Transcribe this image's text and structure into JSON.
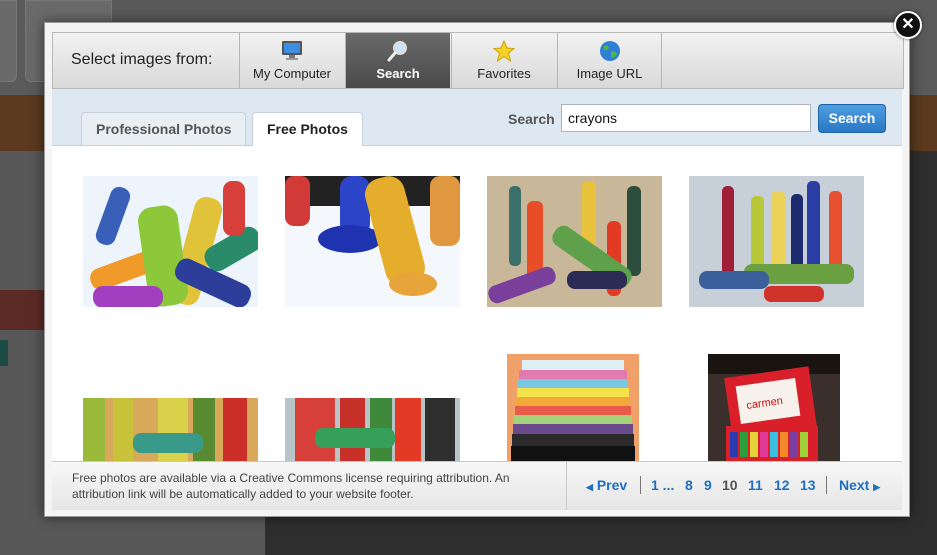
{
  "source_bar": {
    "label": "Select images from:",
    "buttons": [
      {
        "label": "My Computer",
        "icon": "computer-icon",
        "active": false
      },
      {
        "label": "Search",
        "icon": "magnifier-icon",
        "active": true
      },
      {
        "label": "Favorites",
        "icon": "star-icon",
        "active": false
      },
      {
        "label": "Image URL",
        "icon": "globe-icon",
        "active": false
      }
    ]
  },
  "tabs": [
    {
      "label": "Professional Photos",
      "active": false
    },
    {
      "label": "Free Photos",
      "active": true
    }
  ],
  "search": {
    "label": "Search",
    "value": "crayons",
    "button_label": "Search"
  },
  "results": [
    {
      "alt": "crayon-photo-1"
    },
    {
      "alt": "crayon-photo-2"
    },
    {
      "alt": "crayon-photo-3"
    },
    {
      "alt": "crayon-photo-4"
    },
    {
      "alt": "crayon-photo-5"
    },
    {
      "alt": "crayon-photo-6"
    },
    {
      "alt": "crayon-photo-7"
    },
    {
      "alt": "crayon-photo-8"
    }
  ],
  "footer": {
    "note": "Free photos are available via a Creative Commons license requiring attribution. An attribution link will be automatically added to your website footer."
  },
  "pagination": {
    "prev": "Prev",
    "first": "1 ...",
    "pages": [
      "8",
      "9",
      "10",
      "11",
      "12",
      "13"
    ],
    "current": "10",
    "next": "Next"
  },
  "colors": {
    "accent": "#2a77c4",
    "link": "#1f6fbf"
  }
}
